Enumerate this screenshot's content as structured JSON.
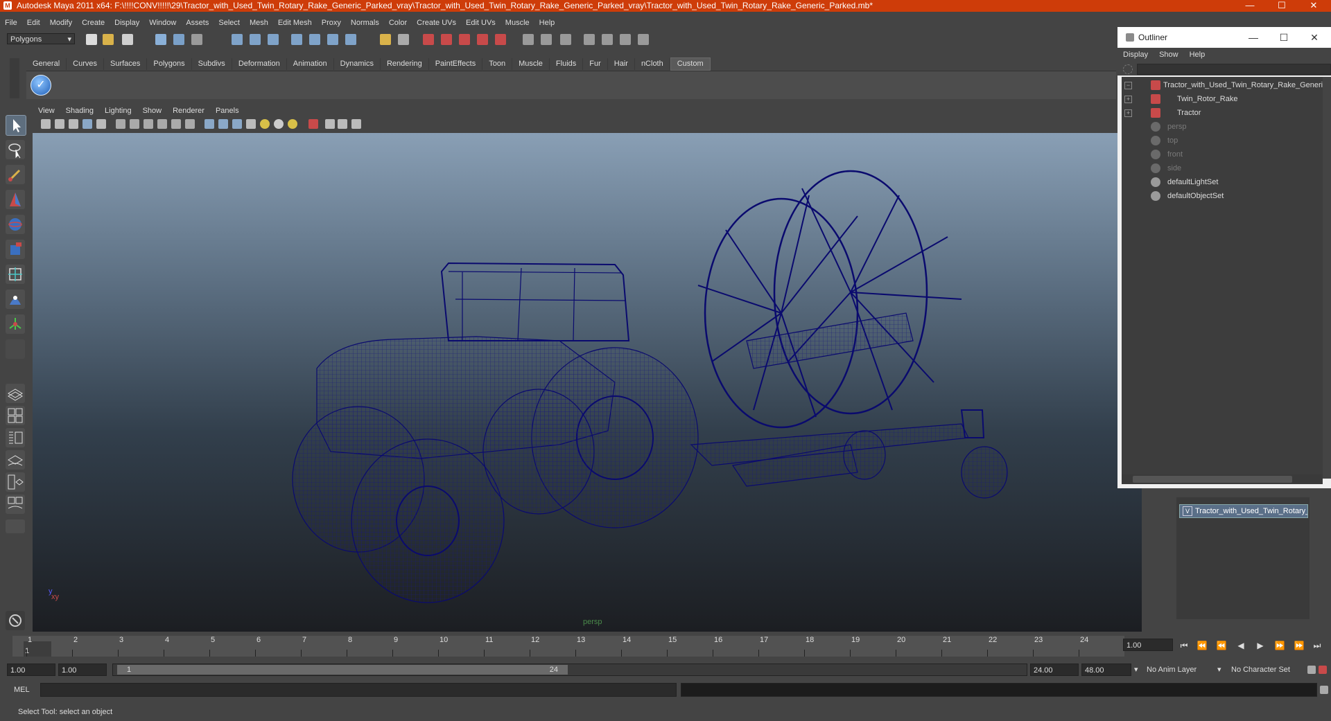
{
  "window": {
    "title": "Autodesk Maya 2011 x64: F:\\!!!!CONV!!!!!\\29\\Tractor_with_Used_Twin_Rotary_Rake_Generic_Parked_vray\\Tractor_with_Used_Twin_Rotary_Rake_Generic_Parked_vray\\Tractor_with_Used_Twin_Rotary_Rake_Generic_Parked.mb*",
    "minimize": "—",
    "maximize": "☐",
    "close": "✕"
  },
  "menubar": [
    "File",
    "Edit",
    "Modify",
    "Create",
    "Display",
    "Window",
    "Assets",
    "Select",
    "Mesh",
    "Edit Mesh",
    "Proxy",
    "Normals",
    "Color",
    "Create UVs",
    "Edit UVs",
    "Muscle",
    "Help"
  ],
  "statusline": {
    "mode": "Polygons"
  },
  "shelf": {
    "tabs": [
      "General",
      "Curves",
      "Surfaces",
      "Polygons",
      "Subdivs",
      "Deformation",
      "Animation",
      "Dynamics",
      "Rendering",
      "PaintEffects",
      "Toon",
      "Muscle",
      "Fluids",
      "Fur",
      "Hair",
      "nCloth",
      "Custom"
    ],
    "active_tab": "Custom"
  },
  "panel": {
    "menu": [
      "View",
      "Shading",
      "Lighting",
      "Show",
      "Renderer",
      "Panels"
    ],
    "camera": "persp",
    "axis_label": "xy"
  },
  "outliner": {
    "title": "Outliner",
    "menu": [
      "Display",
      "Show",
      "Help"
    ],
    "items": [
      {
        "label": "Tractor_with_Used_Twin_Rotary_Rake_Generic_Parked",
        "icon": "transform-icon",
        "expand": "−",
        "indent": 0,
        "dim": false
      },
      {
        "label": "Twin_Rotor_Rake",
        "icon": "transform-icon",
        "expand": "+",
        "indent": 1,
        "dim": false
      },
      {
        "label": "Tractor",
        "icon": "transform-icon",
        "expand": "+",
        "indent": 1,
        "dim": false
      },
      {
        "label": "persp",
        "icon": "camera-icon",
        "expand": "",
        "indent": 0,
        "dim": true
      },
      {
        "label": "top",
        "icon": "camera-icon",
        "expand": "",
        "indent": 0,
        "dim": true
      },
      {
        "label": "front",
        "icon": "camera-icon",
        "expand": "",
        "indent": 0,
        "dim": true
      },
      {
        "label": "side",
        "icon": "camera-icon",
        "expand": "",
        "indent": 0,
        "dim": true
      },
      {
        "label": "defaultLightSet",
        "icon": "set-icon",
        "expand": "",
        "indent": 0,
        "dim": false
      },
      {
        "label": "defaultObjectSet",
        "icon": "set-icon",
        "expand": "",
        "indent": 0,
        "dim": false
      }
    ]
  },
  "layers": {
    "items": [
      {
        "visible": "V",
        "name": "Tractor_with_Used_Twin_Rotary_Rake_Generic_Parked"
      }
    ]
  },
  "timeline": {
    "frames": [
      "1",
      "2",
      "3",
      "4",
      "5",
      "6",
      "7",
      "8",
      "9",
      "10",
      "11",
      "12",
      "13",
      "14",
      "15",
      "16",
      "17",
      "18",
      "19",
      "20",
      "21",
      "22",
      "23",
      "24"
    ],
    "current_frame": "1.00",
    "current_frame_marker": "1"
  },
  "range": {
    "start": "1.00",
    "anim_start": "1.00",
    "slider_start": "1",
    "slider_end": "24",
    "anim_end": "24.00",
    "end": "48.00",
    "anim_layer": "No Anim Layer",
    "character_set": "No Character Set"
  },
  "command": {
    "label": "MEL"
  },
  "help": {
    "text": "Select Tool: select an object"
  },
  "colors": {
    "titlebar": "#ce3c09",
    "wireframe": "#0a0a6e",
    "ui_bg": "#444444"
  }
}
